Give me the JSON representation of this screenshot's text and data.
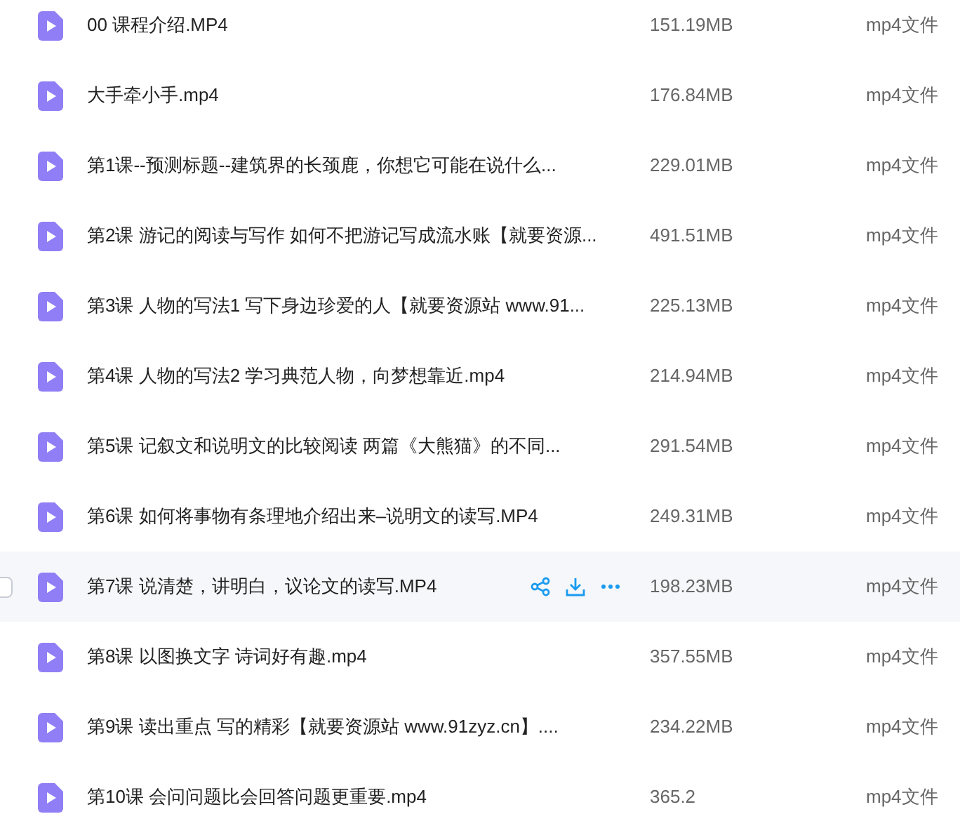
{
  "files": [
    {
      "name": "00 课程介绍.MP4",
      "size": "151.19MB",
      "type": "mp4文件",
      "hovered": false
    },
    {
      "name": "大手牵小手.mp4",
      "size": "176.84MB",
      "type": "mp4文件",
      "hovered": false
    },
    {
      "name": "第1课--预测标题--建筑界的长颈鹿，你想它可能在说什么...",
      "size": "229.01MB",
      "type": "mp4文件",
      "hovered": false
    },
    {
      "name": "第2课 游记的阅读与写作 如何不把游记写成流水账【就要资源...",
      "size": "491.51MB",
      "type": "mp4文件",
      "hovered": false
    },
    {
      "name": "第3课 人物的写法1 写下身边珍爱的人【就要资源站 www.91...",
      "size": "225.13MB",
      "type": "mp4文件",
      "hovered": false
    },
    {
      "name": "第4课 人物的写法2 学习典范人物，向梦想靠近.mp4",
      "size": "214.94MB",
      "type": "mp4文件",
      "hovered": false
    },
    {
      "name": "第5课 记叙文和说明文的比较阅读 两篇《大熊猫》的不同...",
      "size": "291.54MB",
      "type": "mp4文件",
      "hovered": false
    },
    {
      "name": "第6课 如何将事物有条理地介绍出来–说明文的读写.MP4",
      "size": "249.31MB",
      "type": "mp4文件",
      "hovered": false
    },
    {
      "name": "第7课 说清楚，讲明白，议论文的读写.MP4",
      "size": "198.23MB",
      "type": "mp4文件",
      "hovered": true
    },
    {
      "name": "第8课 以图换文字 诗词好有趣.mp4",
      "size": "357.55MB",
      "type": "mp4文件",
      "hovered": false
    },
    {
      "name": "第9课 读出重点 写的精彩【就要资源站 www.91zyz.cn】....",
      "size": "234.22MB",
      "type": "mp4文件",
      "hovered": false
    },
    {
      "name": "第10课 会问问题比会回答问题更重要.mp4",
      "size": "365.2",
      "type": "mp4文件",
      "hovered": false
    }
  ]
}
